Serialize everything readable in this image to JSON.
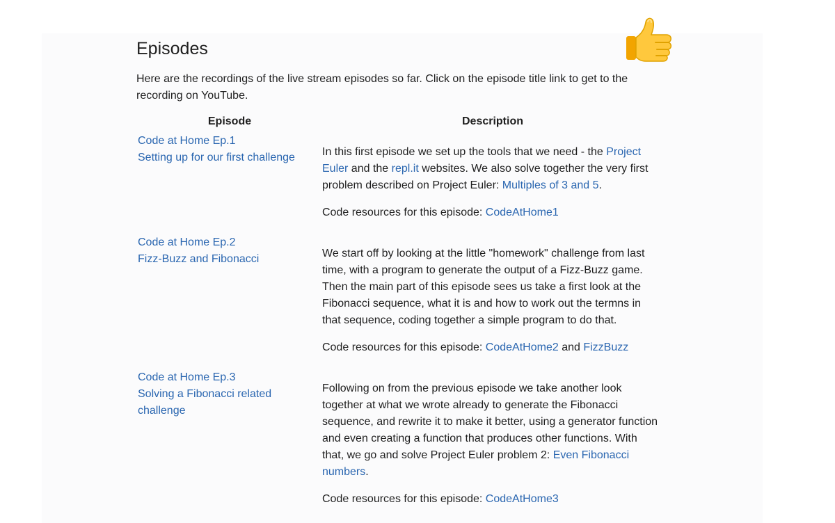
{
  "section": {
    "title": "Episodes",
    "intro": "Here are the recordings of the live stream episodes so far. Click on the episode title link to get to the recording on YouTube.",
    "thumb_icon": "thumbs-up-icon"
  },
  "table": {
    "headers": [
      "Episode",
      "Description"
    ],
    "rows": [
      {
        "ep_line1": "Code at Home Ep.1",
        "ep_line2": "Setting up for our first challenge",
        "desc_t1": "In this first episode we set up the tools that we need - the ",
        "link_project_euler": "Project Euler",
        "desc_t2": " and the ",
        "link_replit": "repl.it",
        "desc_t3": " websites. We also solve together the very first problem described on Project Euler: ",
        "link_multiples": "Multiples of 3 and 5",
        "desc_t4": ".",
        "res_label": "Code resources for this episode: ",
        "res_link1": "CodeAtHome1"
      },
      {
        "ep_line1": "Code at Home Ep.2",
        "ep_line2": "Fizz-Buzz and Fibonacci",
        "desc": "We start off by looking at the little \"homework\" challenge from last time, with a program to generate the output of a Fizz-Buzz game. Then the main part of this episode sees us take a first look at the Fibonacci sequence, what it is and how to work out the termns in that sequence, coding together a simple program to do that.",
        "res_label": "Code resources for this episode: ",
        "res_link1": "CodeAtHome2",
        "res_and": " and ",
        "res_link2": "FizzBuzz"
      },
      {
        "ep_line1": "Code at Home Ep.3",
        "ep_line2": "Solving a Fibonacci related challenge",
        "desc_t1": "Following on from the previous episode we take another look together at what we wrote already to generate the Fibonacci sequence, and rewrite it to make it better, using a generator function and even creating a function that produces other functions. With that, we go and solve Project Euler problem 2: ",
        "link_even": "Even Fibonacci numbers",
        "desc_t2": ".",
        "res_label": "Code resources for this episode: ",
        "res_link1": "CodeAtHome3"
      }
    ]
  }
}
